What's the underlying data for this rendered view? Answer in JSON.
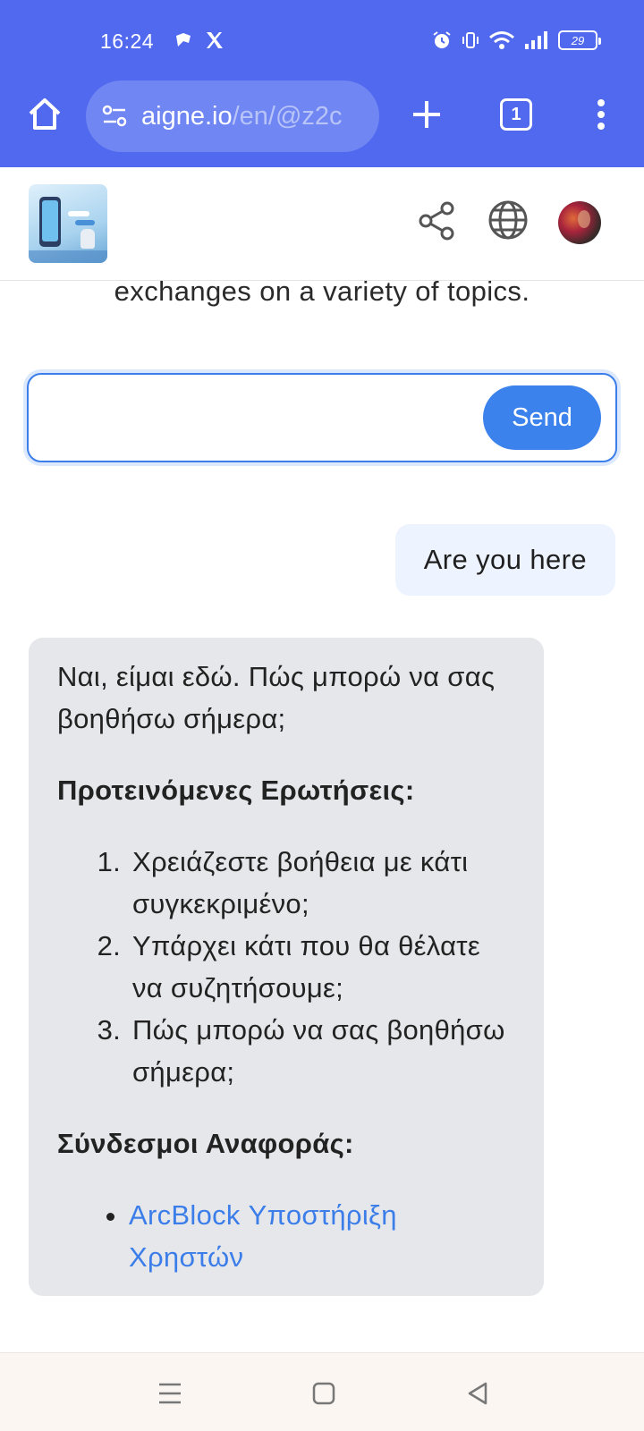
{
  "status_bar": {
    "time": "16:24",
    "battery": "29"
  },
  "browser": {
    "url_host": "aigne.io",
    "url_path": "/en/@z2c",
    "tab_count": "1",
    "icons": [
      "home-icon",
      "site-settings-icon",
      "plus-icon",
      "tabs-icon",
      "more-vert-icon"
    ]
  },
  "header": {
    "icons": [
      "share-icon",
      "globe-icon"
    ]
  },
  "intro": {
    "tail": "exchanges on a variety of topics."
  },
  "composer": {
    "value": "",
    "send_label": "Send"
  },
  "messages": {
    "user": "Are you here",
    "bot": {
      "greeting": "Ναι, είμαι εδώ. Πώς μπορώ να σας βοηθήσω σήμερα;",
      "suggested_heading": "Προτεινόμενες Ερωτήσεις:",
      "suggested": [
        "Χρειάζεστε βοήθεια με κάτι συγκεκριμένο;",
        "Υπάρχει κάτι που θα θέλατε να συζητήσουμε;",
        "Πώς μπορώ να σας βοηθήσω σήμερα;"
      ],
      "links_heading": "Σύνδεσμοι Αναφοράς:",
      "links": [
        "ArcBlock Υποστήριξη Χρηστών"
      ]
    }
  },
  "colors": {
    "browser_bar": "#5169ee",
    "accent": "#3c82ec",
    "bot_bubble": "#e6e7ea",
    "user_bubble": "#eef4ff"
  }
}
